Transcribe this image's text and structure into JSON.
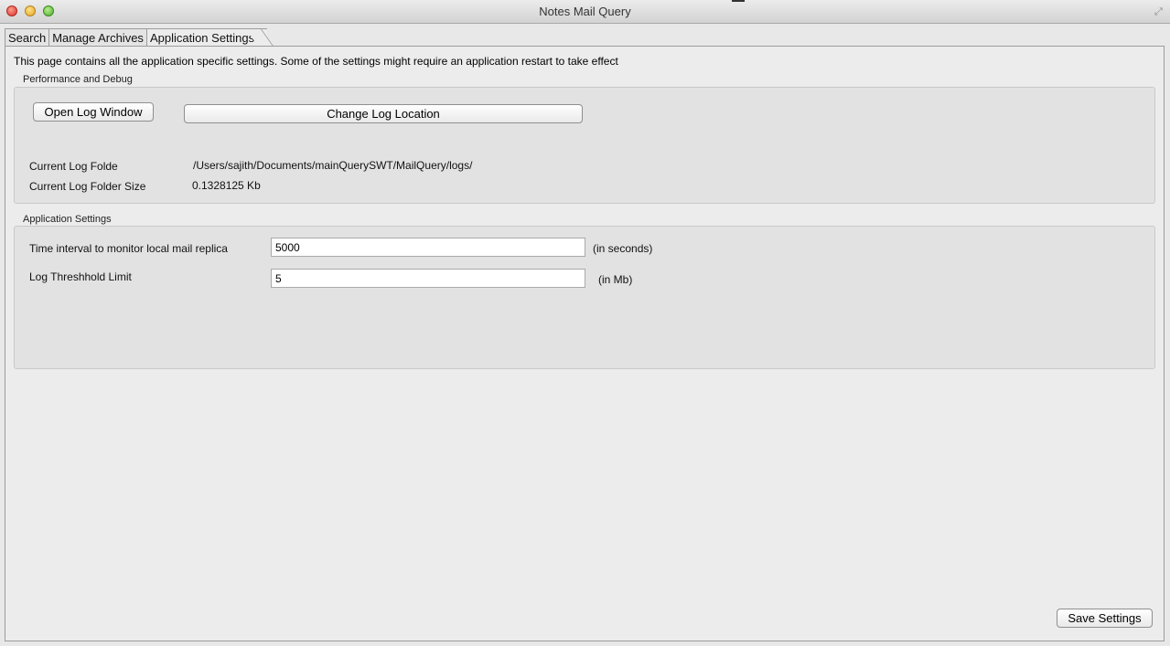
{
  "window": {
    "title": "Notes Mail Query"
  },
  "tabs": [
    {
      "label": "Search"
    },
    {
      "label": "Manage Archives"
    },
    {
      "label": "Application Settings"
    }
  ],
  "page": {
    "intro": "This page contains all the application specific settings. Some of the settings might require an application restart to take effect"
  },
  "performance": {
    "group_label": "Performance and Debug",
    "open_log_button": "Open Log Window",
    "change_log_button": "Change Log Location",
    "log_folder_label": "Current Log Folde",
    "log_folder_value": "/Users/sajith/Documents/mainQuerySWT/MailQuery/logs/",
    "log_size_label": "Current Log Folder Size",
    "log_size_value": "0.1328125 Kb"
  },
  "app_settings": {
    "group_label": "Application Settings",
    "interval_label": "Time interval to monitor local mail replica",
    "interval_value": "5000",
    "interval_unit": "(in seconds)",
    "threshold_label": "Log Threshhold Limit",
    "threshold_value": "5",
    "threshold_unit": "(in Mb)"
  },
  "footer": {
    "save_button": "Save Settings"
  }
}
